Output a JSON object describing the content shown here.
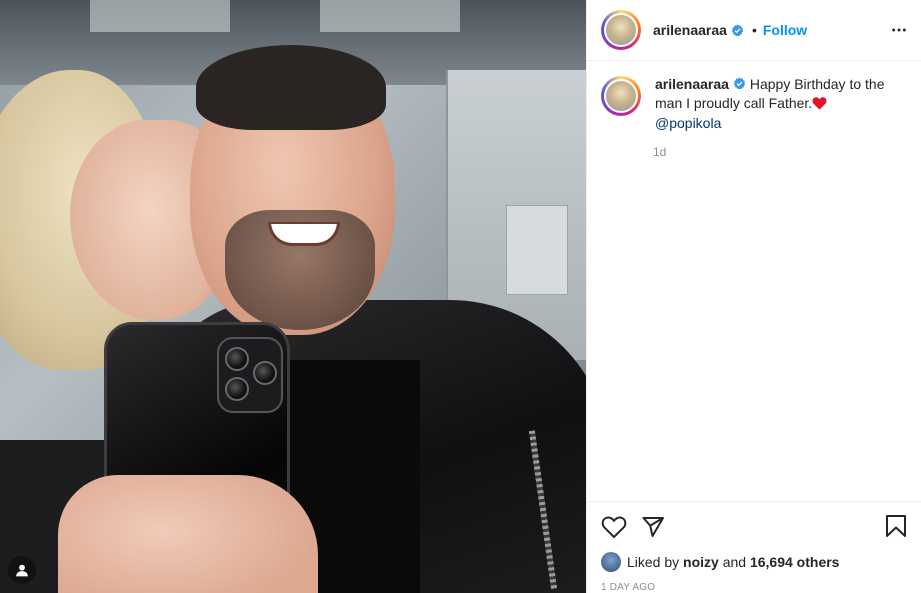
{
  "post": {
    "author": {
      "username": "arilenaaraa",
      "verified": true
    },
    "header": {
      "separator": "•",
      "follow_label": "Follow",
      "more_icon": "more-horizontal-icon"
    },
    "caption": {
      "username": "arilenaaraa",
      "text": "Happy Birthday to the man I proudly call Father.",
      "emoji": "red-heart-icon",
      "mention": "@popikola",
      "age": "1d"
    },
    "actions": {
      "like_icon": "heart-outline-icon",
      "share_icon": "send-icon",
      "save_icon": "bookmark-icon"
    },
    "likes": {
      "prefix": "Liked by",
      "user": "noizy",
      "connector": "and",
      "others": "16,694 others"
    },
    "timestamp": "1 day ago",
    "photo": {
      "tag_icon": "user-tag-icon"
    },
    "colors": {
      "accent": "#0095f6",
      "mention": "#00376b",
      "muted": "#8e8e8e",
      "heart": "#ed4956",
      "verified": "#3897f0"
    }
  }
}
